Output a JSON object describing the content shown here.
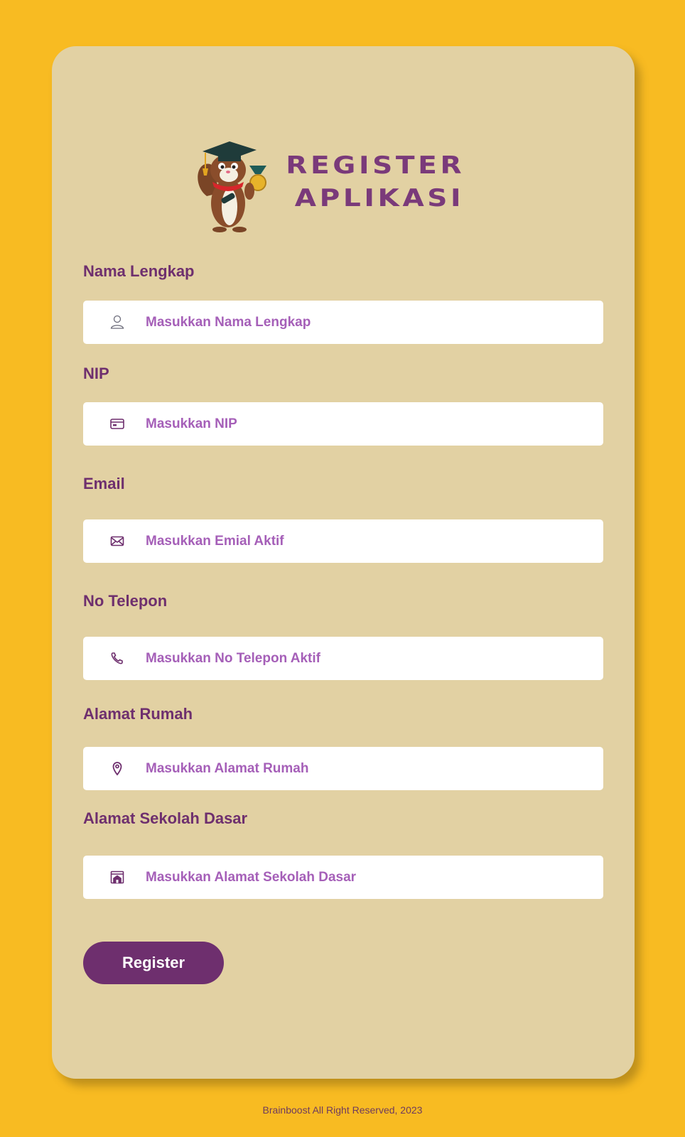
{
  "header": {
    "title_line1": "REGISTER",
    "title_line2": "APLIKASI",
    "logo_icon": "graduate-squirrel-mascot"
  },
  "form": {
    "fields": [
      {
        "label": "Nama Lengkap",
        "placeholder": "Masukkan Nama Lengkap",
        "icon": "user-icon"
      },
      {
        "label": "NIP",
        "placeholder": "Masukkan NIP",
        "icon": "id-card-icon"
      },
      {
        "label": "Email",
        "placeholder": "Masukkan Emial Aktif",
        "icon": "envelope-icon"
      },
      {
        "label": "No Telepon",
        "placeholder": "Masukkan No Telepon Aktif",
        "icon": "phone-icon"
      },
      {
        "label": "Alamat Rumah",
        "placeholder": "Masukkan Alamat Rumah",
        "icon": "location-pin-icon"
      },
      {
        "label": "Alamat Sekolah Dasar",
        "placeholder": "Masukkan Alamat Sekolah Dasar",
        "icon": "school-building-icon"
      }
    ],
    "submit_label": "Register"
  },
  "footer": {
    "text": "Brainboost All Right Reserved, 2023"
  },
  "colors": {
    "background": "#f8bb22",
    "card": "#e2d1a3",
    "primary": "#6e2f6e",
    "placeholder": "#a55fb8"
  }
}
